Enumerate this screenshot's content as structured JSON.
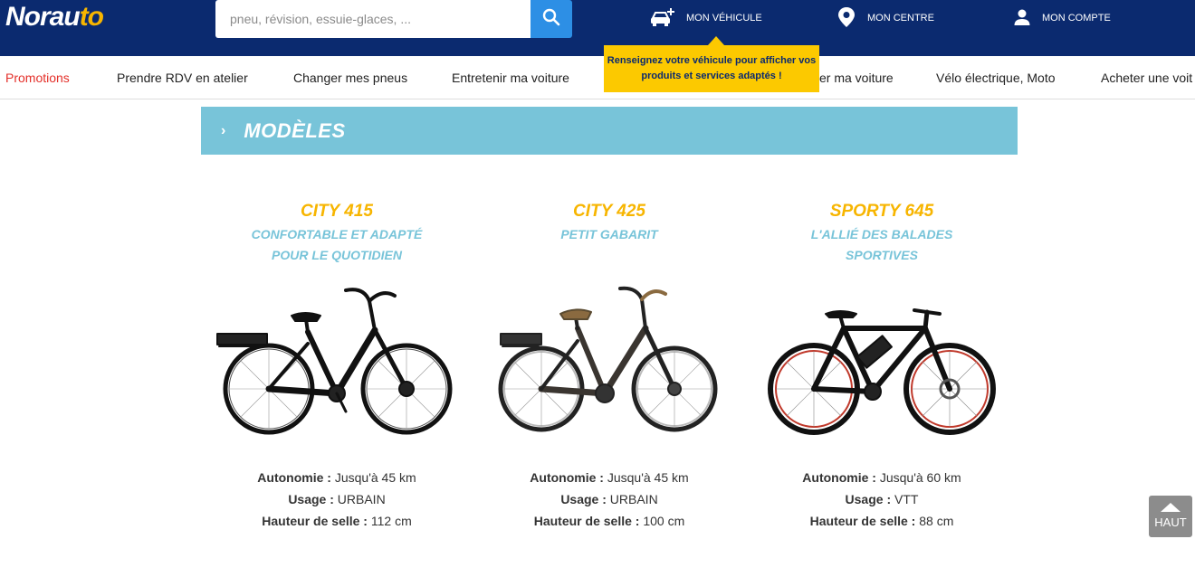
{
  "header": {
    "logo_main": "Norau",
    "logo_accent": "to",
    "search_placeholder": "pneu, révision, essuie-glaces, ...",
    "links": {
      "vehicle": "MON VÉHICULE",
      "centre": "MON CENTRE",
      "account": "MON COMPTE"
    },
    "tooltip": "Renseignez votre véhicule pour afficher vos produits et services adaptés !"
  },
  "nav": {
    "items": [
      "Promotions",
      "Prendre RDV en atelier",
      "Changer mes pneus",
      "Entretenir ma voiture",
      "er ma voiture",
      "Vélo électrique, Moto",
      "Acheter une voit"
    ]
  },
  "section": {
    "chevron": "›",
    "title": "MODÈLES"
  },
  "models": [
    {
      "name": "CITY 415",
      "tagline": "CONFORTABLE ET ADAPTÉ POUR LE QUOTIDIEN",
      "autonomie_label": "Autonomie :",
      "autonomie": "Jusqu'à 45 km",
      "usage_label": "Usage :",
      "usage": "URBAIN",
      "selle_label": "Hauteur de selle :",
      "selle": "112 cm"
    },
    {
      "name": "CITY 425",
      "tagline": "PETIT GABARIT",
      "autonomie_label": "Autonomie :",
      "autonomie": "Jusqu'à 45 km",
      "usage_label": "Usage :",
      "usage": "URBAIN",
      "selle_label": "Hauteur de selle :",
      "selle": "100 cm"
    },
    {
      "name": "SPORTY 645",
      "tagline": "L'ALLIÉ DES BALADES SPORTIVES",
      "autonomie_label": "Autonomie :",
      "autonomie": "Jusqu'à 60 km",
      "usage_label": "Usage :",
      "usage": "VTT",
      "selle_label": "Hauteur de selle :",
      "selle": "88 cm"
    }
  ],
  "back_to_top": "HAUT",
  "colors": {
    "header_bg": "#0b2a6f",
    "accent_yellow": "#f7b500",
    "tooltip_yellow": "#fcc900",
    "banner_blue": "#78c4d9",
    "search_button": "#2d8fe5",
    "promo_red": "#e4302a"
  },
  "icons": {
    "search": "search-icon",
    "vehicle": "car-plus-icon",
    "centre": "map-pin-icon",
    "account": "user-icon",
    "back_to_top": "triangle-up-icon"
  }
}
